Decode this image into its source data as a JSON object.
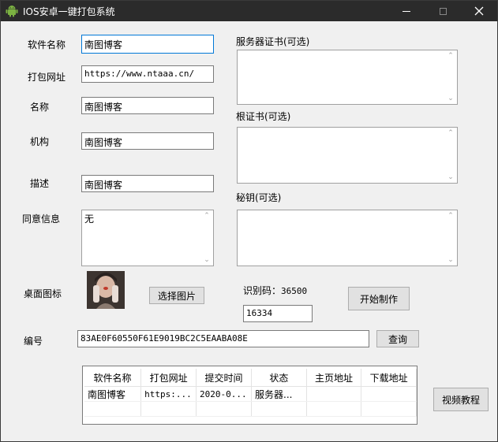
{
  "window": {
    "title": "IOS安卓一键打包系统",
    "icon": "android-icon"
  },
  "form": {
    "app_name": {
      "label": "软件名称",
      "value": "南图博客"
    },
    "pack_url": {
      "label": "打包网址",
      "value": "https://www.ntaaa.cn/"
    },
    "name": {
      "label": "名称",
      "value": "南图博客"
    },
    "org": {
      "label": "机构",
      "value": "南图博客"
    },
    "desc": {
      "label": "描述",
      "value": "南图博客"
    },
    "consent": {
      "label": "同意信息",
      "value": "无"
    },
    "desktop_icon": {
      "label": "桌面图标",
      "button": "选择图片"
    },
    "code": {
      "label": "编号",
      "value": "83AE0F60550F61E9019BC2C5EAABA08E",
      "button": "查询"
    }
  },
  "certs": {
    "server_cert": {
      "label": "服务器证书(可选)",
      "value": ""
    },
    "root_cert": {
      "label": "根证书(可选)",
      "value": ""
    },
    "secret_key": {
      "label": "秘钥(可选)",
      "value": ""
    }
  },
  "captcha": {
    "label": "识别码：",
    "code": "36500",
    "input_value": "16334",
    "start_button": "开始制作"
  },
  "table": {
    "columns": [
      "软件名称",
      "打包网址",
      "提交时间",
      "状态",
      "主页地址",
      "下载地址"
    ],
    "rows": [
      [
        "南图博客",
        "https:...",
        "2020-0...",
        "服务器...",
        "",
        ""
      ]
    ]
  },
  "video_button": "视频教程",
  "colors": {
    "titlebar": "#2b2b2b",
    "focus_border": "#0078d7",
    "window_bg": "#f0f0f0"
  }
}
